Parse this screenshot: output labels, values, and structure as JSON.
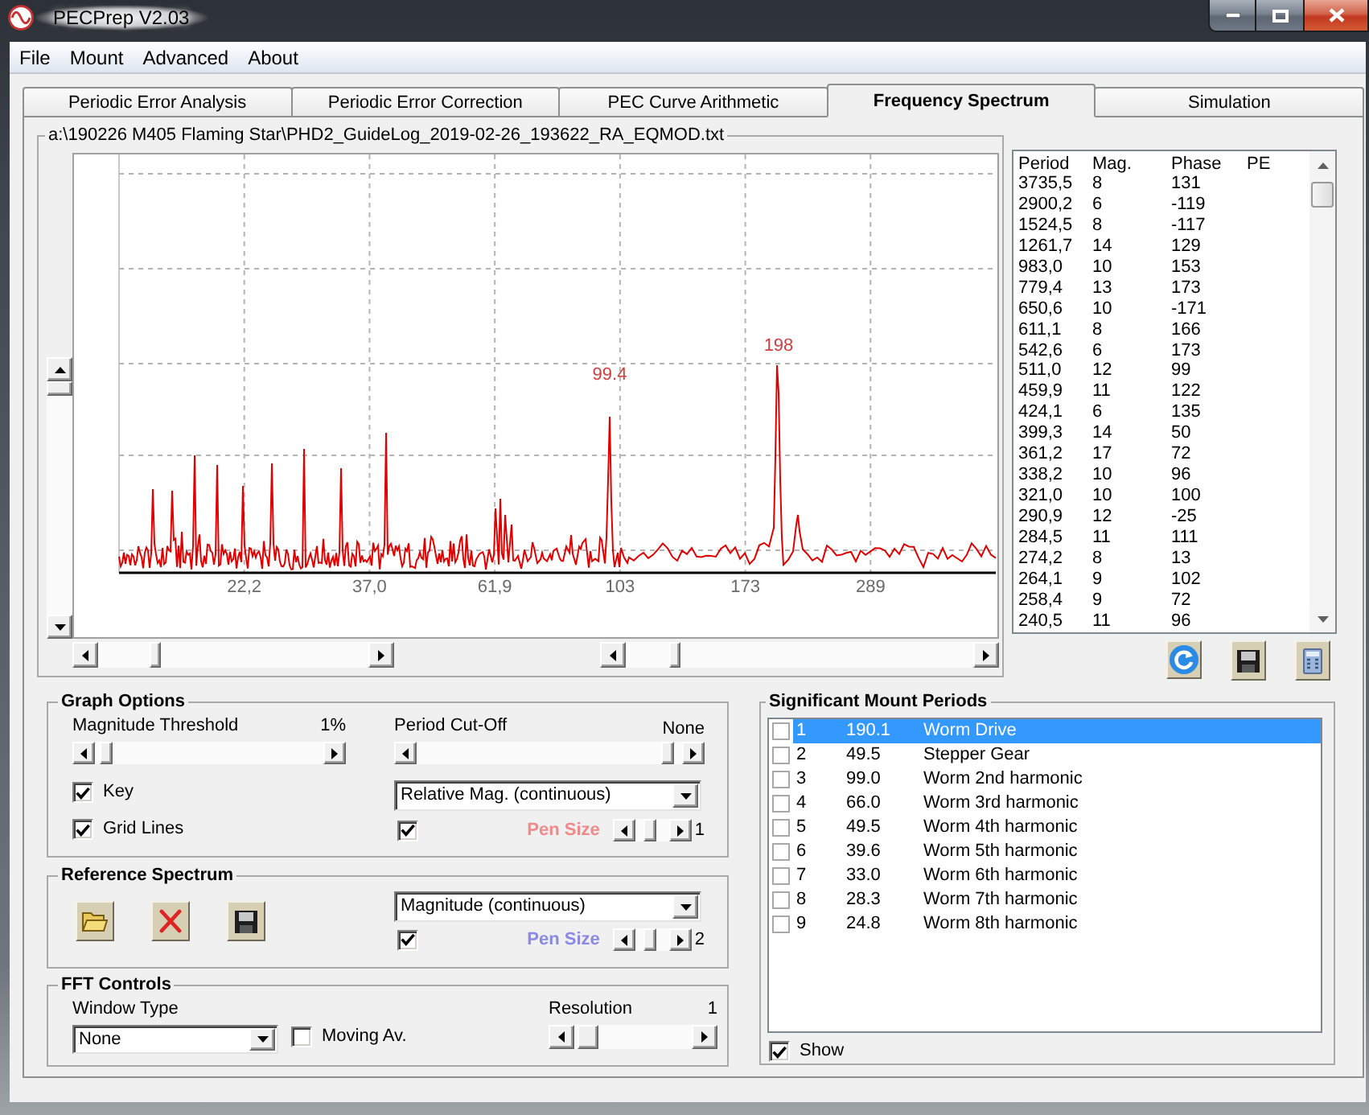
{
  "window": {
    "title": "PECPrep V2.03"
  },
  "menu": [
    "File",
    "Mount",
    "Advanced",
    "About"
  ],
  "tabs": [
    {
      "label": "Periodic Error Analysis",
      "selected": false
    },
    {
      "label": "Periodic Error Correction",
      "selected": false
    },
    {
      "label": "PEC Curve Arithmetic",
      "selected": false
    },
    {
      "label": "Frequency Spectrum",
      "selected": true
    },
    {
      "label": "Simulation",
      "selected": false
    }
  ],
  "spectrum": {
    "file_path": "a:\\190226 M405 Flaming Star\\PHD2_GuideLog_2019-02-26_193622_RA_EQMOD.txt",
    "x_tick_labels": [
      "22,2",
      "37,0",
      "61,9",
      "103",
      "173",
      "289"
    ],
    "peak_labels": [
      "99.4",
      "198"
    ]
  },
  "spectrum_table": {
    "columns": [
      "Period",
      "Mag.",
      "Phase",
      "PE"
    ],
    "rows": [
      [
        "3735,5",
        "8",
        "131"
      ],
      [
        "2900,2",
        "6",
        "-119"
      ],
      [
        "1524,5",
        "8",
        "-117"
      ],
      [
        "1261,7",
        "14",
        "129"
      ],
      [
        "983,0",
        "10",
        "153"
      ],
      [
        "779,4",
        "13",
        "173"
      ],
      [
        "650,6",
        "10",
        "-171"
      ],
      [
        "611,1",
        "8",
        "166"
      ],
      [
        "542,6",
        "6",
        "173"
      ],
      [
        "511,0",
        "12",
        "99"
      ],
      [
        "459,9",
        "11",
        "122"
      ],
      [
        "424,1",
        "6",
        "135"
      ],
      [
        "399,3",
        "14",
        "50"
      ],
      [
        "361,2",
        "17",
        "72"
      ],
      [
        "338,2",
        "10",
        "96"
      ],
      [
        "321,0",
        "10",
        "100"
      ],
      [
        "290,9",
        "12",
        "-25"
      ],
      [
        "284,5",
        "11",
        "111"
      ],
      [
        "274,2",
        "8",
        "13"
      ],
      [
        "264,1",
        "9",
        "102"
      ],
      [
        "258,4",
        "9",
        "72"
      ],
      [
        "240,5",
        "11",
        "96"
      ]
    ]
  },
  "graph_options": {
    "title": "Graph Options",
    "magnitude_threshold": {
      "label": "Magnitude Threshold",
      "reading": "1%",
      "level": 0.02
    },
    "period_cutoff": {
      "label": "Period Cut-Off",
      "reading": "None",
      "level": 0.97
    },
    "key": {
      "label": "Key",
      "checked": true
    },
    "grid_lines": {
      "label": "Grid Lines",
      "checked": true
    },
    "display_mode": {
      "value": "Relative Mag. (continuous)"
    },
    "pen": {
      "checked": true,
      "label": "Pen Size",
      "color": "#f08a8a",
      "reading": "1",
      "level": 0.4
    }
  },
  "reference_spectrum": {
    "title": "Reference Spectrum",
    "display_mode": {
      "value": "Magnitude (continuous)"
    },
    "pen": {
      "checked": true,
      "label": "Pen Size",
      "color": "#8a8ae6",
      "reading": "2",
      "level": 0.4
    }
  },
  "fft_controls": {
    "title": "FFT Controls",
    "window_type": {
      "label": "Window Type",
      "value": "None"
    },
    "moving_average": {
      "label": "Moving Av.",
      "checked": false
    },
    "resolution": {
      "label": "Resolution",
      "reading": "1",
      "level": 0.03
    }
  },
  "significant_periods": {
    "title": "Significant Mount Periods",
    "rows": [
      {
        "number": "1",
        "period": "190.1",
        "name": "Worm Drive",
        "checked": false,
        "selected": true
      },
      {
        "number": "2",
        "period": "49.5",
        "name": "Stepper Gear",
        "checked": false,
        "selected": false
      },
      {
        "number": "3",
        "period": "99.0",
        "name": "Worm 2nd harmonic",
        "checked": false,
        "selected": false
      },
      {
        "number": "4",
        "period": "66.0",
        "name": "Worm 3rd harmonic",
        "checked": false,
        "selected": false
      },
      {
        "number": "5",
        "period": "49.5",
        "name": "Worm 4th harmonic",
        "checked": false,
        "selected": false
      },
      {
        "number": "6",
        "period": "39.6",
        "name": "Worm 5th harmonic",
        "checked": false,
        "selected": false
      },
      {
        "number": "7",
        "period": "33.0",
        "name": "Worm 6th harmonic",
        "checked": false,
        "selected": false
      },
      {
        "number": "8",
        "period": "28.3",
        "name": "Worm 7th harmonic",
        "checked": false,
        "selected": false
      },
      {
        "number": "9",
        "period": "24.8",
        "name": "Worm 8th harmonic",
        "checked": false,
        "selected": false
      }
    ],
    "show": {
      "label": "Show",
      "checked": true
    }
  }
}
